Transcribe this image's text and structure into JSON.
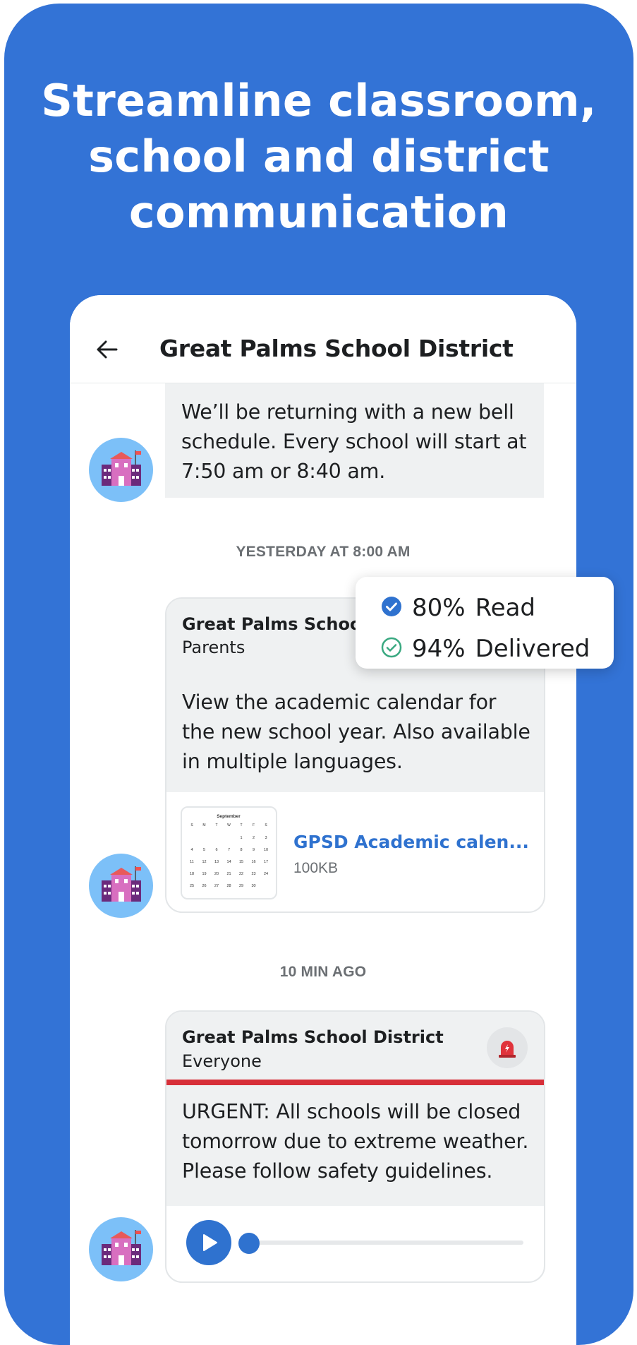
{
  "headline": {
    "line1": "Streamline classroom,",
    "line2": "school and district",
    "line3": "communication"
  },
  "colors": {
    "frame": "#3373d6",
    "accent": "#2f72cf",
    "urgent": "#d72f38",
    "avatar_bg": "#7cc0f8",
    "bubble_bg": "#eff1f2",
    "delivered": "#3aa981"
  },
  "topbar": {
    "title": "Great Palms School District",
    "back_icon": "arrow-left-icon"
  },
  "messages": [
    {
      "text": "We’ll be returning with a new bell schedule. Every school will start at 7:50 am or 8:40 am.",
      "avatar_icon": "school-building-icon"
    },
    {
      "timestamp": "YESTERDAY AT 8:00 AM",
      "sender": "Great Palms School District",
      "audience": "Parents",
      "text": "View the academic calendar for the new school year. Also available in multiple languages.",
      "avatar_icon": "school-building-icon",
      "attachment": {
        "name": "GPSD Academic calen...",
        "size": "100KB",
        "thumb": {
          "month": "September",
          "weekdays": [
            "S",
            "M",
            "T",
            "W",
            "T",
            "F",
            "S"
          ],
          "weeks": [
            [
              "",
              "",
              "",
              "",
              "1",
              "2",
              "3"
            ],
            [
              "4",
              "5",
              "6",
              "7",
              "8",
              "9",
              "10"
            ],
            [
              "11",
              "12",
              "13",
              "14",
              "15",
              "16",
              "17"
            ],
            [
              "18",
              "19",
              "20",
              "21",
              "22",
              "23",
              "24"
            ],
            [
              "25",
              "26",
              "27",
              "28",
              "29",
              "30",
              ""
            ]
          ]
        }
      }
    },
    {
      "timestamp": "10 MIN AGO",
      "sender": "Great Palms School District",
      "audience": "Everyone",
      "text": "URGENT: All schools will be closed tomorrow due to extreme weather. Please follow safety guidelines.",
      "avatar_icon": "school-building-icon",
      "badge_icon": "siren-alarm-icon",
      "audio": {
        "progress": 0.02,
        "play_icon": "play-icon"
      }
    }
  ],
  "stats": {
    "read": {
      "value": "80%",
      "label": "Read",
      "icon": "check-circle-filled-icon"
    },
    "delivered": {
      "value": "94%",
      "label": "Delivered",
      "icon": "check-circle-outline-icon"
    }
  }
}
